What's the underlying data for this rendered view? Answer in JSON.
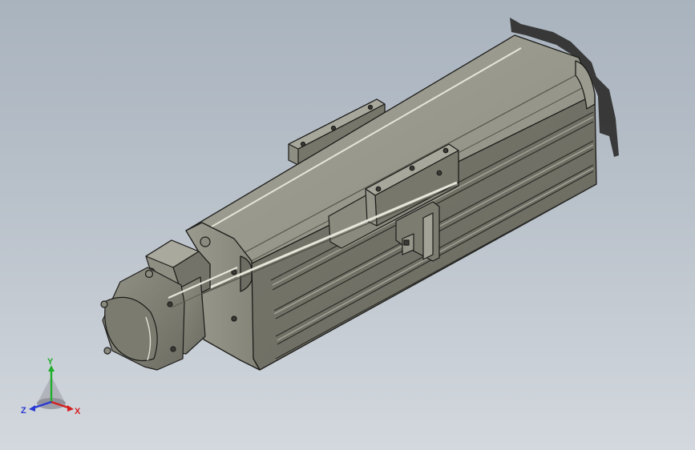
{
  "scene": {
    "background_top": "#a9b3be",
    "background_bottom": "#d3d8de",
    "body_color": "#8b8b80",
    "edge_color": "#1c1c1a"
  },
  "triad": {
    "x_label": "X",
    "y_label": "Y",
    "z_label": "Z",
    "x_color": "#d42020",
    "y_color": "#1fae2a",
    "z_color": "#2a3ad2"
  }
}
